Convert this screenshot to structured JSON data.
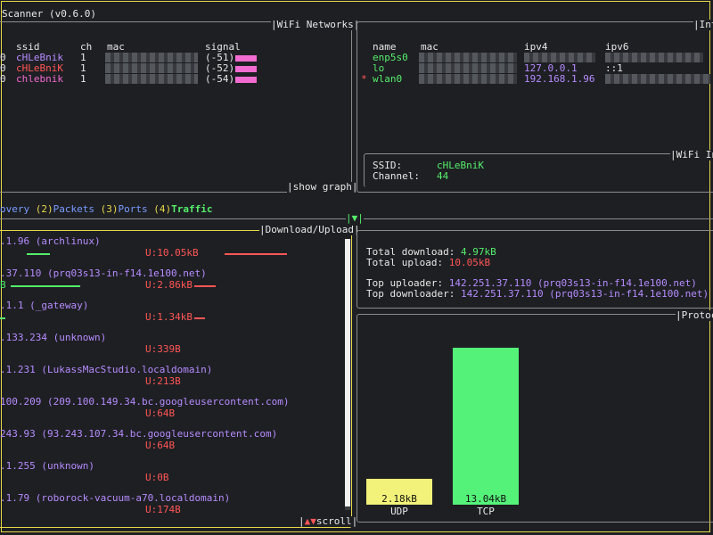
{
  "app": {
    "title": "Scanner (v0.6.0)"
  },
  "wifi": {
    "title": "|WiFi Networks|",
    "headers": {
      "ssid": "ssid",
      "ch": "ch",
      "mac": "mac",
      "signal": "signal"
    },
    "rows": [
      {
        "mark": "0",
        "ssid": "cHLeBnik",
        "ch": "1",
        "signal": "(-51)",
        "color": "#b58cff"
      },
      {
        "mark": "0",
        "ssid": "cHLeBniK",
        "ch": "1",
        "signal": "(-52)",
        "color": "#ff5656"
      },
      {
        "mark": "0",
        "ssid": "chlebnik",
        "ch": "1",
        "signal": "(-54)",
        "color": "#f26bd0"
      }
    ],
    "show_graph": "|show graph|"
  },
  "interfaces": {
    "title": "|Inte",
    "headers": {
      "name": "name",
      "mac": "mac",
      "ipv4": "ipv4",
      "ipv6": "ipv6"
    },
    "rows": [
      {
        "mark": "",
        "name": "enp5s0",
        "ipv4": "",
        "ipv6": ""
      },
      {
        "mark": "",
        "name": "lo",
        "ipv4": "127.0.0.1",
        "ipv6": "::1"
      },
      {
        "mark": "*",
        "name": "wlan0",
        "ipv4": "192.168.1.96",
        "ipv6": ""
      }
    ]
  },
  "wifi_info": {
    "title": "|WiFi In",
    "ssid_label": "SSID:",
    "ssid_value": "cHLeBniK",
    "channel_label": "Channel:",
    "channel_value": "44"
  },
  "tabs": [
    {
      "label": "overy ",
      "num": ""
    },
    {
      "label": "Packets ",
      "num": "(2)"
    },
    {
      "label": "Ports ",
      "num": "(3)"
    },
    {
      "label": "Traffic",
      "num": "(4)"
    }
  ],
  "panel_toggle": "|▼|",
  "download_upload": {
    "title": "|Download/Upload|",
    "scroll": "|▲▼scroll|",
    "entries": [
      {
        "host": ".1.96 (archlinux)",
        "down": "",
        "up": "U:10.05kB"
      },
      {
        "host": ".37.110 (prq03s13-in-f14.1e100.net)",
        "down": "B",
        "up": "U:2.86kB"
      },
      {
        "host": ".1.1 (_gateway)",
        "down": "",
        "up": "U:1.34kB"
      },
      {
        "host": ".133.234 (unknown)",
        "down": "",
        "up": "U:339B"
      },
      {
        "host": ".1.231 (LukassMacStudio.localdomain)",
        "down": "",
        "up": "U:213B"
      },
      {
        "host": "100.209 (209.100.149.34.bc.googleusercontent.com)",
        "down": "",
        "up": "U:64B"
      },
      {
        "host": "243.93 (93.243.107.34.bc.googleusercontent.com)",
        "down": "",
        "up": "U:64B"
      },
      {
        "host": ".1.255 (unknown)",
        "down": "",
        "up": "U:0B"
      },
      {
        "host": ".1.79 (roborock-vacuum-a70.localdomain)",
        "down": "",
        "up": "U:174B"
      }
    ]
  },
  "totals": {
    "download_label": "Total download: ",
    "download_value": "4.97kB",
    "upload_label": "Total upload: ",
    "upload_value": "10.05kB",
    "top_uploader_label": "Top uploader: ",
    "top_uploader_value": "142.251.37.110 (prq03s13-in-f14.1e100.net)",
    "top_downloader_label": "Top downloader: ",
    "top_downloader_value": "142.251.37.110 (prq03s13-in-f14.1e100.net)"
  },
  "protocols": {
    "title": "|Protoc",
    "chart_data": {
      "type": "bar",
      "categories": [
        "UDP",
        "TCP"
      ],
      "values": [
        2.18,
        13.04
      ],
      "value_labels": [
        "2.18kB",
        "13.04kB"
      ],
      "colors": [
        "#f2f27a",
        "#55f27a"
      ],
      "ylim": [
        0,
        14.5
      ]
    }
  }
}
